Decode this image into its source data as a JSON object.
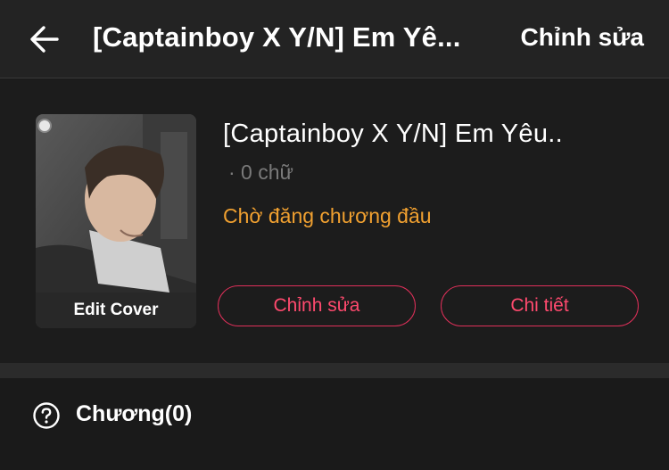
{
  "header": {
    "title": "[Captainboy X Y/N] Em Yê...",
    "edit_label": "Chỉnh sửa",
    "back_icon": "arrow-left-icon"
  },
  "story": {
    "cover_label": "Edit Cover",
    "title": "[Captainboy X Y/N] Em Yêu..",
    "word_count": "· 0 chữ",
    "status": "Chờ đăng chương đầu",
    "edit_button": "Chỉnh sửa",
    "detail_button": "Chi tiết"
  },
  "chapters": {
    "label": "Chương(0)",
    "icon": "question-circle-icon"
  },
  "colors": {
    "background": "#1a1a1a",
    "header_bg": "#232323",
    "accent_pink": "#ff4a6e",
    "status_orange": "#f0a030",
    "muted_text": "#7a7a7a"
  }
}
